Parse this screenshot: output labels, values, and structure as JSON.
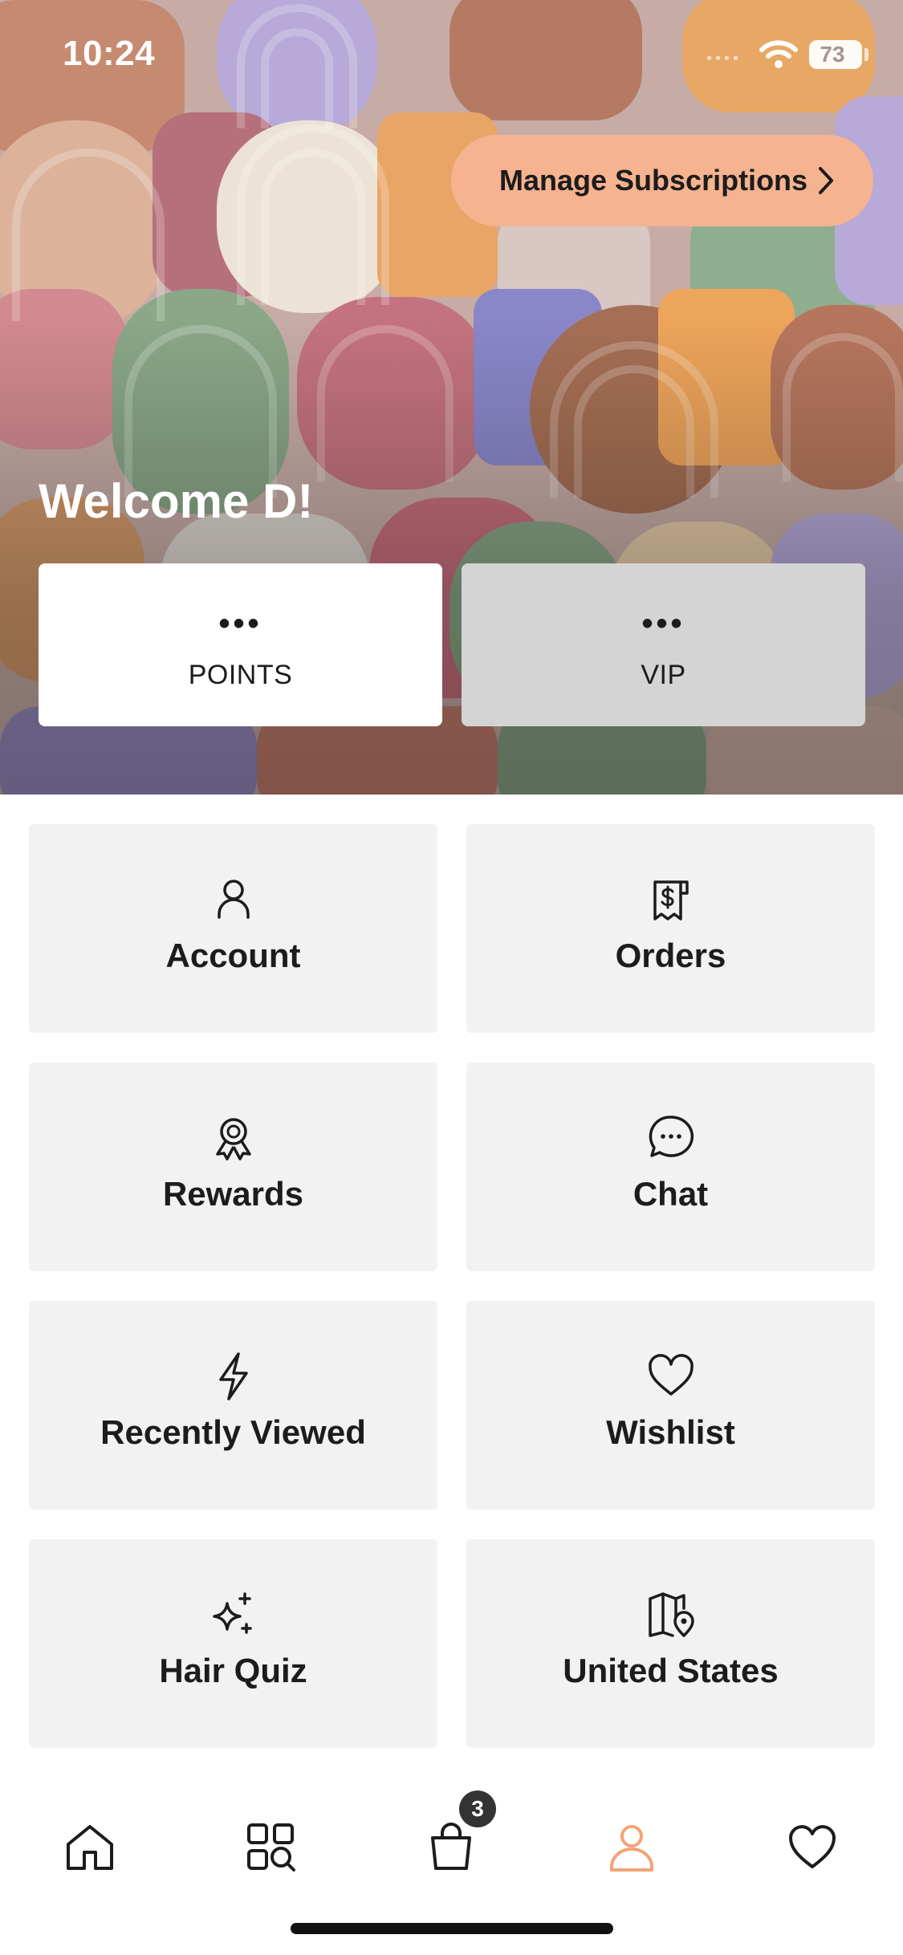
{
  "status_bar": {
    "time": "10:24",
    "battery": "73"
  },
  "hero": {
    "manage_subscriptions_label": "Manage Subscriptions",
    "welcome_text": "Welcome D!",
    "points": {
      "value": "•••",
      "label": "POINTS"
    },
    "vip": {
      "value": "•••",
      "label": "VIP"
    }
  },
  "menu": {
    "items": [
      {
        "label": "Account",
        "icon": "person-icon"
      },
      {
        "label": "Orders",
        "icon": "receipt-dollar-icon"
      },
      {
        "label": "Rewards",
        "icon": "award-ribbon-icon"
      },
      {
        "label": "Chat",
        "icon": "chat-bubble-icon"
      },
      {
        "label": "Recently Viewed",
        "icon": "lightning-icon"
      },
      {
        "label": "Wishlist",
        "icon": "heart-icon"
      },
      {
        "label": "Hair Quiz",
        "icon": "sparkles-icon"
      },
      {
        "label": "United States",
        "icon": "map-pin-icon"
      }
    ]
  },
  "tabbar": {
    "cart_badge": "3",
    "active_tab": "account",
    "tabs": [
      "home-icon",
      "browse-search-icon",
      "cart-bag-icon",
      "account-icon",
      "wishlist-heart-icon"
    ]
  },
  "colors": {
    "accent": "#f6b38f",
    "active_tab": "#f2a478",
    "tile_bg": "#f2f2f2"
  }
}
